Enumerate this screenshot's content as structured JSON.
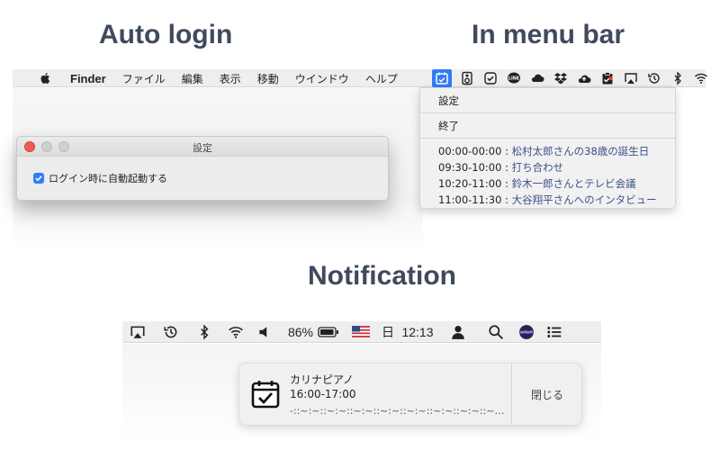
{
  "headings": {
    "auto_login": "Auto login",
    "in_menu_bar": "In menu bar",
    "notification": "Notification"
  },
  "finder_menubar": {
    "apple_icon": "apple-icon",
    "items": [
      "Finder",
      "ファイル",
      "編集",
      "表示",
      "移動",
      "ウインドウ",
      "ヘルプ"
    ]
  },
  "status_icons": [
    "calendar-app-icon",
    "speaker-box-icon",
    "checkmark-circle-icon",
    "line-icon",
    "cloud-icon",
    "dropbox-icon",
    "cloud-upload-icon",
    "clipboard-icon",
    "airplay-icon",
    "time-machine-icon",
    "bluetooth-icon",
    "wifi-icon"
  ],
  "settings_window": {
    "title": "設定",
    "checkbox_label": "ログイン時に自動起動する",
    "checked": true
  },
  "dropdown": {
    "settings_label": "設定",
    "quit_label": "終了",
    "events": [
      {
        "time": "00:00-00:00 : ",
        "title": "松村太郎さんの38歳の誕生日"
      },
      {
        "time": "09:30-10:00 : ",
        "title": "打ち合わせ"
      },
      {
        "time": "10:20-11:00 : ",
        "title": "鈴木一郎さんとテレビ会議"
      },
      {
        "time": "11:00-11:30 : ",
        "title": "大谷翔平さんへのインタビュー"
      }
    ]
  },
  "notif_menubar": {
    "battery": "86%",
    "day": "日",
    "clock": "12:13"
  },
  "notification": {
    "title": "カリナピアノ",
    "time": "16:00-17:00",
    "body": "-::~:~::~:~::~:~::~:~::~:~::~:~::~:~::~:~::~:~::~:~::~:~::~:~::~...",
    "close_label": "閉じる"
  },
  "colors": {
    "heading": "#3f4a5c",
    "accent": "#2e7cf6",
    "event_title": "#3c4f8a"
  }
}
